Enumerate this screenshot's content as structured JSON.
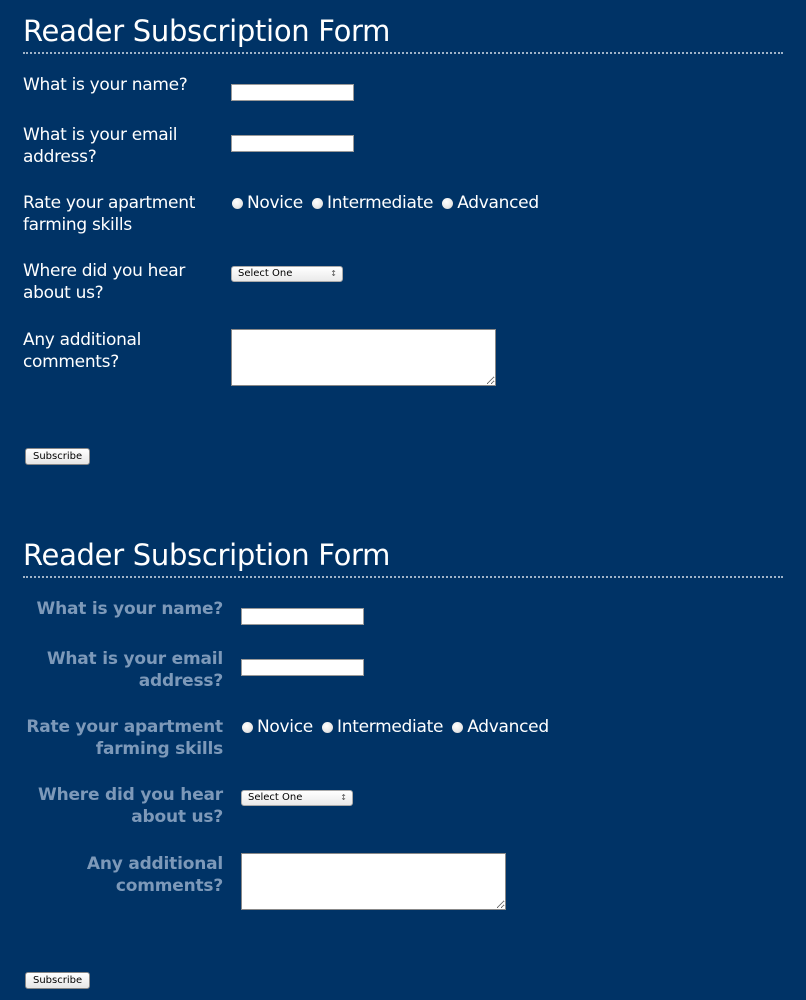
{
  "forms": [
    {
      "title": "Reader Subscription Form",
      "label_style": "left-aligned, white",
      "fields": {
        "name_label": "What is your name?",
        "name_value": "",
        "email_label": "What is your email address?",
        "email_value": "",
        "skills_label": "Rate your apartment farming skills",
        "skills_options": [
          "Novice",
          "Intermediate",
          "Advanced"
        ],
        "hear_label": "Where did you hear about us?",
        "hear_selected": "Select One",
        "comments_label": "Any additional comments?",
        "comments_value": ""
      },
      "submit_label": "Subscribe"
    },
    {
      "title": "Reader Subscription Form",
      "label_style": "right-aligned, bold, muted blue",
      "fields": {
        "name_label": "What is your name?",
        "name_value": "",
        "email_label": "What is your email address?",
        "email_value": "",
        "skills_label": "Rate your apartment farming skills",
        "skills_options": [
          "Novice",
          "Intermediate",
          "Advanced"
        ],
        "hear_label": "Where did you hear about us?",
        "hear_selected": "Select One",
        "comments_label": "Any additional comments?",
        "comments_value": ""
      },
      "submit_label": "Subscribe"
    }
  ],
  "colors": {
    "background": "#003366",
    "text": "#ffffff",
    "muted_label": "#7d99b9",
    "divider": "#9fb3c8"
  }
}
